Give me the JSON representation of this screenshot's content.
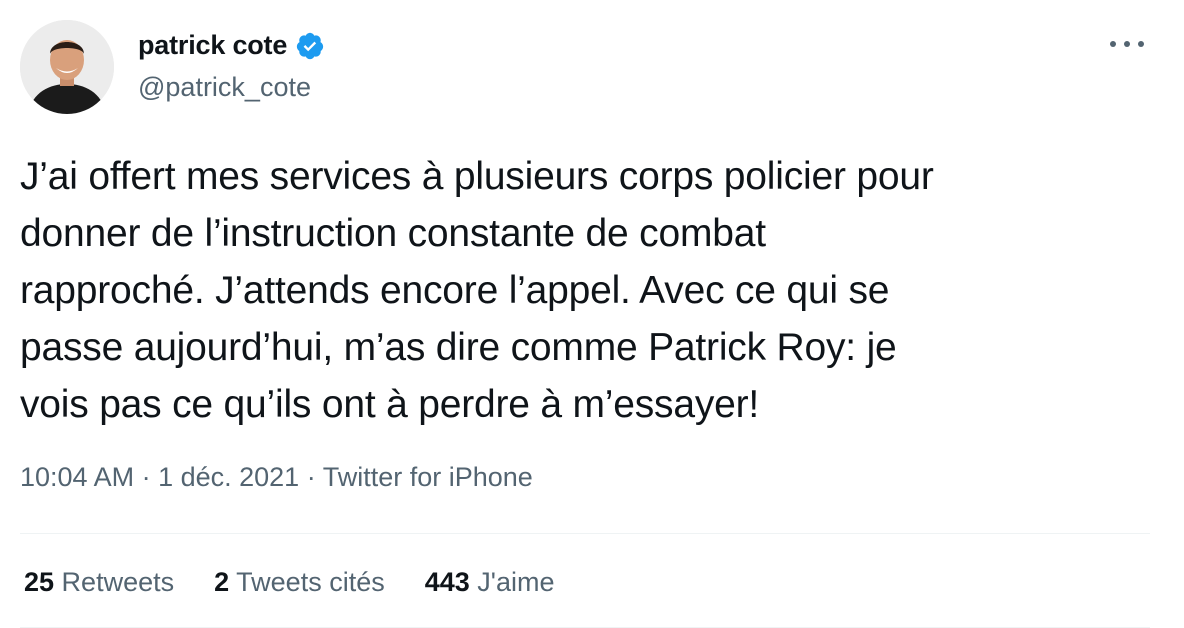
{
  "author": {
    "name": "patrick cote",
    "handle": "@patrick_cote",
    "verified": true,
    "avatar_icon": "avatar-photo"
  },
  "tweet": {
    "text": "J’ai offert mes services à plusieurs corps policier pour\ndonner de l’instruction constante de combat\nrapproché. J’attends encore l’appel. Avec ce qui se\npasse aujourd’hui, m’as dire comme Patrick Roy: je\nvois pas ce qu’ils ont à perdre à m’essayer!",
    "time": "10:04 AM",
    "separator1": " · ",
    "date": "1 déc. 2021",
    "separator2": " · ",
    "source": "Twitter for iPhone"
  },
  "stats": {
    "retweets_count": "25",
    "retweets_label": " Retweets",
    "quotes_count": "2",
    "quotes_label": " Tweets cités",
    "likes_count": "443",
    "likes_label": " J'aime"
  },
  "colors": {
    "verified_blue": "#1d9bf0",
    "secondary_text": "#536471",
    "primary_text": "#0f1419"
  }
}
